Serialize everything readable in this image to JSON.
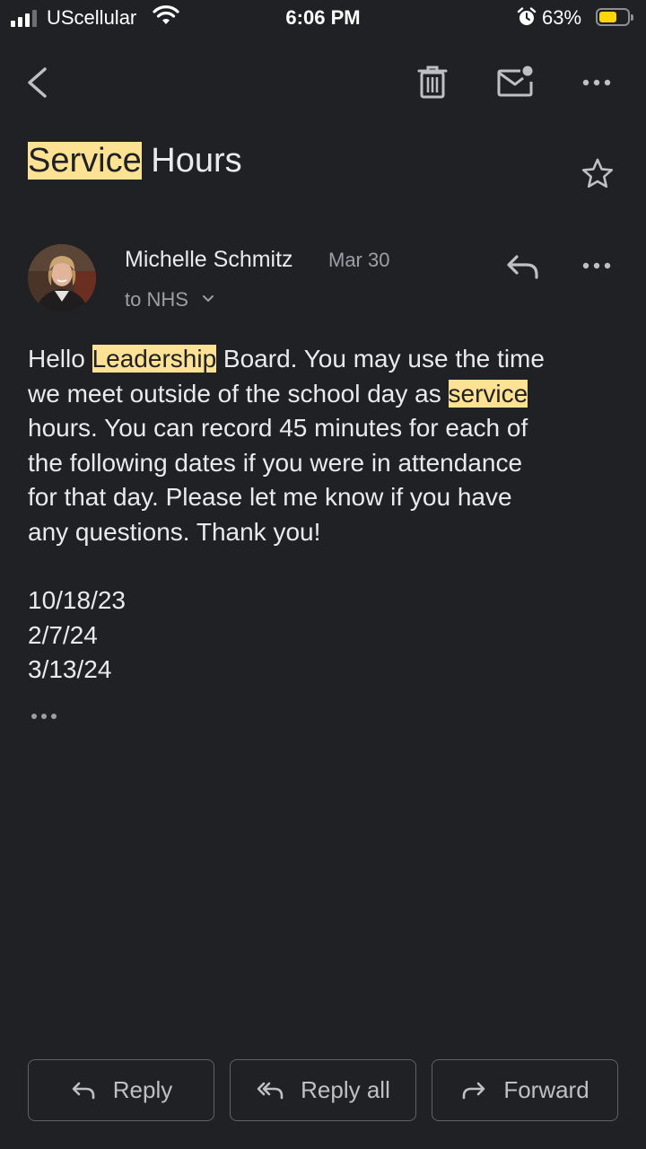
{
  "status_bar": {
    "carrier": "UScellular",
    "time": "6:06 PM",
    "battery_percent": "63%",
    "battery_level": 0.63,
    "battery_color": "#ffd60a",
    "icons": [
      "signal-icon",
      "wifi-icon",
      "alarm-icon",
      "battery-icon"
    ]
  },
  "toolbar": {
    "icons": [
      "back-icon",
      "delete-icon",
      "mark-unread-icon",
      "more-icon"
    ]
  },
  "email": {
    "subject_highlight": "Service",
    "subject_rest": " Hours",
    "sender": "Michelle Schmitz",
    "date": "Mar 30",
    "recipients": "to NHS",
    "body": {
      "l1_a": "Hello ",
      "l1_hl": "Leadership",
      "l1_b": " Board. You may use the time",
      "l2_a": "we meet outside of the school day as ",
      "l2_hl": "service",
      "l3": "hours. You can record 45 minutes for each of",
      "l4": "the following dates if you were in attendance",
      "l5": "for that day. Please let me know if you have",
      "l6": "any questions. Thank you!"
    },
    "dates": [
      "10/18/23",
      "2/7/24",
      "3/13/24"
    ]
  },
  "actions": {
    "reply": "Reply",
    "reply_all": "Reply all",
    "forward": "Forward"
  },
  "colors": {
    "background": "#202124",
    "highlight": "#fde293",
    "text": "#e8eaed",
    "secondary_text": "#9aa0a6"
  }
}
